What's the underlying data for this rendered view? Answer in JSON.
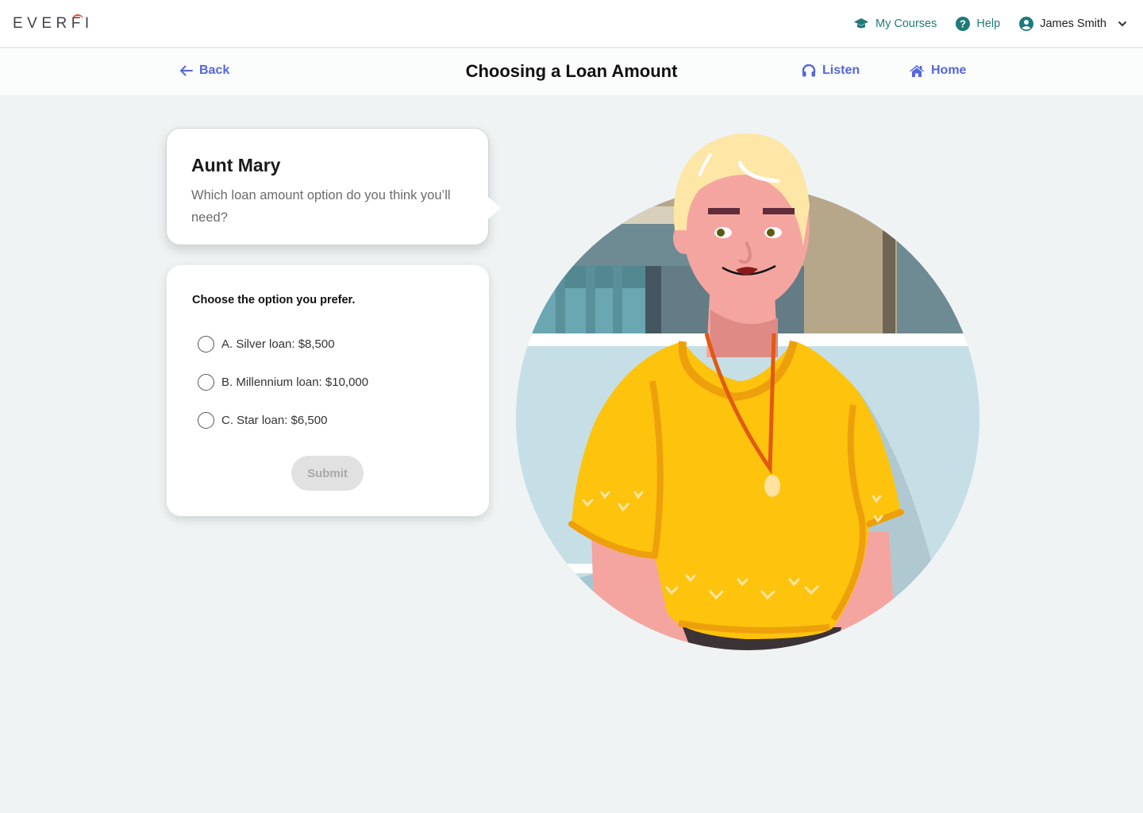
{
  "header": {
    "logo": {
      "left": "EVER",
      "right": "FI",
      "accent_color": "#e8492b"
    },
    "nav": [
      {
        "label": "My Courses",
        "icon": "graduation-cap-icon"
      },
      {
        "label": "Help",
        "icon": "help-circle-icon"
      },
      {
        "label": "James Smith",
        "icon": "user-circle-icon",
        "menu_icon": "chevron-down-icon"
      }
    ],
    "teal_color": "#1f7b7a"
  },
  "subheader": {
    "back_label": "Back",
    "title": "Choosing a Loan Amount",
    "listen_label": "Listen",
    "home_label": "Home",
    "link_color": "#5467dc"
  },
  "dialogue": {
    "speaker": "Aunt Mary",
    "text": "Which loan amount option do you think you’ll need?"
  },
  "question": {
    "prompt": "Choose the option you prefer.",
    "options": [
      {
        "label": "A. Silver loan: $8,500",
        "selected": false
      },
      {
        "label": "B. Millennium loan: $10,000",
        "selected": false
      },
      {
        "label": "C. Star loan: $6,500",
        "selected": false
      }
    ],
    "submit_label": "Submit",
    "submit_enabled": false
  },
  "illustration": {
    "subject": "Aunt Mary character portrait",
    "colors": {
      "shirt": "#fec30d",
      "shirt_trim": "#eda00c",
      "skin": "#f5a5a0",
      "hair": "#fde6a6",
      "lanyard": "#e05a14",
      "backdrop": "#c6dfe7"
    }
  }
}
